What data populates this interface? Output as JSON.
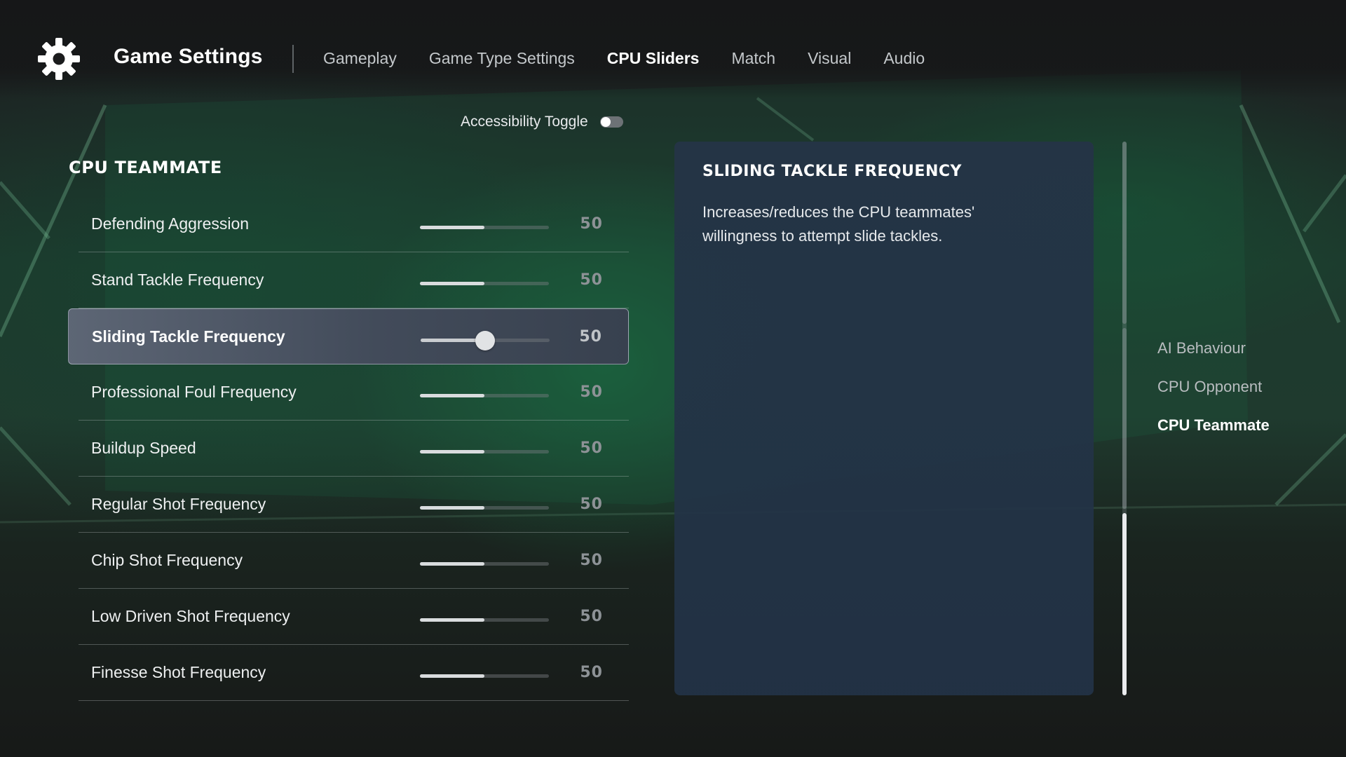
{
  "header": {
    "title": "Game Settings",
    "tabs": [
      {
        "label": "Gameplay",
        "active": false
      },
      {
        "label": "Game Type Settings",
        "active": false
      },
      {
        "label": "CPU Sliders",
        "active": true
      },
      {
        "label": "Match",
        "active": false
      },
      {
        "label": "Visual",
        "active": false
      },
      {
        "label": "Audio",
        "active": false
      }
    ]
  },
  "accessibility": {
    "label": "Accessibility Toggle",
    "on": false
  },
  "section": {
    "title": "CPU TEAMMATE"
  },
  "sliders": [
    {
      "label": "Defending Aggression",
      "value": "50",
      "fraction": 0.5,
      "selected": false
    },
    {
      "label": "Stand Tackle Frequency",
      "value": "50",
      "fraction": 0.5,
      "selected": false
    },
    {
      "label": "Sliding Tackle Frequency",
      "value": "50",
      "fraction": 0.5,
      "selected": true
    },
    {
      "label": "Professional Foul Frequency",
      "value": "50",
      "fraction": 0.5,
      "selected": false
    },
    {
      "label": "Buildup Speed",
      "value": "50",
      "fraction": 0.5,
      "selected": false
    },
    {
      "label": "Regular Shot Frequency",
      "value": "50",
      "fraction": 0.5,
      "selected": false
    },
    {
      "label": "Chip Shot Frequency",
      "value": "50",
      "fraction": 0.5,
      "selected": false
    },
    {
      "label": "Low Driven Shot Frequency",
      "value": "50",
      "fraction": 0.5,
      "selected": false
    },
    {
      "label": "Finesse Shot Frequency",
      "value": "50",
      "fraction": 0.5,
      "selected": false
    }
  ],
  "description": {
    "title": "SLIDING TACKLE FREQUENCY",
    "body": "Increases/reduces the CPU teammates' willingness to attempt slide tackles."
  },
  "side_nav": [
    {
      "label": "AI Behaviour",
      "active": false
    },
    {
      "label": "CPU Opponent",
      "active": false
    },
    {
      "label": "CPU Teammate",
      "active": true
    }
  ],
  "colors": {
    "accent": "#ffffff",
    "panel": "#22344a",
    "selected_row": "#4f5868"
  },
  "icons": {
    "settings": "gear-icon"
  }
}
